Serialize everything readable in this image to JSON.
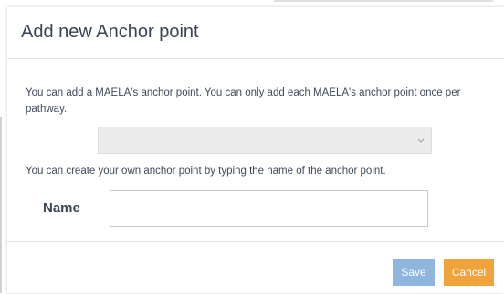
{
  "dialog": {
    "title": "Add new Anchor point",
    "info_text": "You can add a MAELA's anchor point. You can only add each MAELA's anchor point once per pathway.",
    "select": {
      "value": "",
      "caret_icon": "chevron-down-icon"
    },
    "create_text": "You can create your own anchor point by typing the name of the anchor point.",
    "name_field": {
      "label": "Name",
      "value": "",
      "placeholder": ""
    },
    "buttons": {
      "save_label": "Save",
      "cancel_label": "Cancel"
    }
  },
  "colors": {
    "title": "#3a4453",
    "body_text": "#3f4a59",
    "select_bg": "#ececec",
    "save_button": "#8fb6de",
    "cancel_button": "#f0a33a"
  }
}
